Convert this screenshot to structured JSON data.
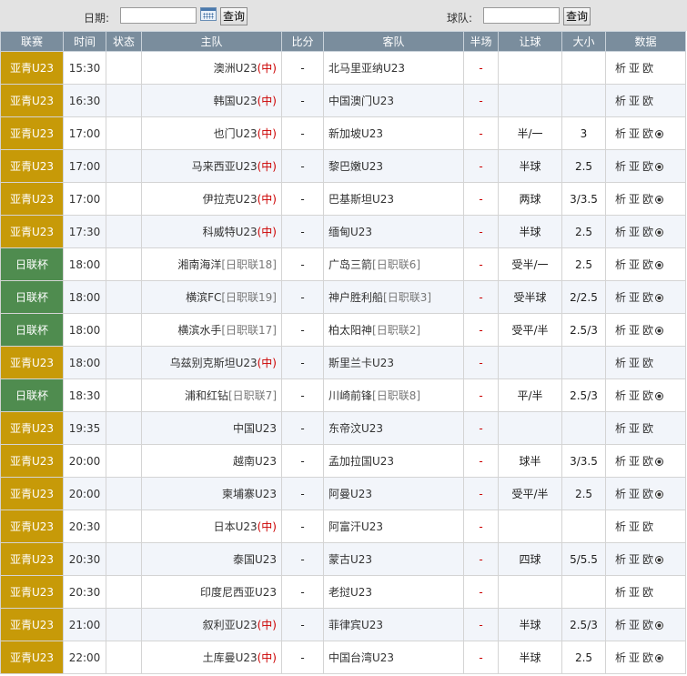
{
  "filter": {
    "date_label": "日期:",
    "date_value": "",
    "query_label": "查询",
    "team_label": "球队:",
    "team_value": ""
  },
  "columns": [
    "联赛",
    "时间",
    "状态",
    "主队",
    "比分",
    "客队",
    "半场",
    "让球",
    "大小",
    "数据"
  ],
  "data_links": [
    "析",
    "亚",
    "欧"
  ],
  "colors": {
    "yq": "#c79a08",
    "jl": "#4f8c4f",
    "header": "#7a8d9d",
    "neutral": "#cc0000"
  },
  "rows": [
    {
      "league": "亚青U23",
      "cls": "yq",
      "time": "15:30",
      "home": "澳洲U23",
      "home_tag": "(中)",
      "home_rank": "",
      "score": "-",
      "away": "北马里亚纳U23",
      "away_rank": "",
      "half": "-",
      "handicap": "",
      "ou": "",
      "ball": false
    },
    {
      "league": "亚青U23",
      "cls": "yq",
      "time": "16:30",
      "home": "韩国U23",
      "home_tag": "(中)",
      "home_rank": "",
      "score": "-",
      "away": "中国澳门U23",
      "away_rank": "",
      "half": "-",
      "handicap": "",
      "ou": "",
      "ball": false
    },
    {
      "league": "亚青U23",
      "cls": "yq",
      "time": "17:00",
      "home": "也门U23",
      "home_tag": "(中)",
      "home_rank": "",
      "score": "-",
      "away": "新加坡U23",
      "away_rank": "",
      "half": "-",
      "handicap": "半/一",
      "ou": "3",
      "ball": true
    },
    {
      "league": "亚青U23",
      "cls": "yq",
      "time": "17:00",
      "home": "马来西亚U23",
      "home_tag": "(中)",
      "home_rank": "",
      "score": "-",
      "away": "黎巴嫩U23",
      "away_rank": "",
      "half": "-",
      "handicap": "半球",
      "ou": "2.5",
      "ball": true
    },
    {
      "league": "亚青U23",
      "cls": "yq",
      "time": "17:00",
      "home": "伊拉克U23",
      "home_tag": "(中)",
      "home_rank": "",
      "score": "-",
      "away": "巴基斯坦U23",
      "away_rank": "",
      "half": "-",
      "handicap": "两球",
      "ou": "3/3.5",
      "ball": true
    },
    {
      "league": "亚青U23",
      "cls": "yq",
      "time": "17:30",
      "home": "科威特U23",
      "home_tag": "(中)",
      "home_rank": "",
      "score": "-",
      "away": "缅甸U23",
      "away_rank": "",
      "half": "-",
      "handicap": "半球",
      "ou": "2.5",
      "ball": true
    },
    {
      "league": "日联杯",
      "cls": "jl",
      "time": "18:00",
      "home": "湘南海洋",
      "home_tag": "",
      "home_rank": "[日职联18]",
      "score": "-",
      "away": "广岛三箭",
      "away_rank": "[日职联6]",
      "half": "-",
      "handicap": "受半/一",
      "ou": "2.5",
      "ball": true
    },
    {
      "league": "日联杯",
      "cls": "jl",
      "time": "18:00",
      "home": "横滨FC",
      "home_tag": "",
      "home_rank": "[日职联19]",
      "score": "-",
      "away": "神户胜利船",
      "away_rank": "[日职联3]",
      "half": "-",
      "handicap": "受半球",
      "ou": "2/2.5",
      "ball": true
    },
    {
      "league": "日联杯",
      "cls": "jl",
      "time": "18:00",
      "home": "横滨水手",
      "home_tag": "",
      "home_rank": "[日职联17]",
      "score": "-",
      "away": "柏太阳神",
      "away_rank": "[日职联2]",
      "half": "-",
      "handicap": "受平/半",
      "ou": "2.5/3",
      "ball": true
    },
    {
      "league": "亚青U23",
      "cls": "yq",
      "time": "18:00",
      "home": "乌兹别克斯坦U23",
      "home_tag": "(中)",
      "home_rank": "",
      "score": "-",
      "away": "斯里兰卡U23",
      "away_rank": "",
      "half": "-",
      "handicap": "",
      "ou": "",
      "ball": false
    },
    {
      "league": "日联杯",
      "cls": "jl",
      "time": "18:30",
      "home": "浦和红钻",
      "home_tag": "",
      "home_rank": "[日职联7]",
      "score": "-",
      "away": "川崎前锋",
      "away_rank": "[日职联8]",
      "half": "-",
      "handicap": "平/半",
      "ou": "2.5/3",
      "ball": true
    },
    {
      "league": "亚青U23",
      "cls": "yq",
      "time": "19:35",
      "home": "中国U23",
      "home_tag": "",
      "home_rank": "",
      "score": "-",
      "away": "东帝汶U23",
      "away_rank": "",
      "half": "-",
      "handicap": "",
      "ou": "",
      "ball": false
    },
    {
      "league": "亚青U23",
      "cls": "yq",
      "time": "20:00",
      "home": "越南U23",
      "home_tag": "",
      "home_rank": "",
      "score": "-",
      "away": "孟加拉国U23",
      "away_rank": "",
      "half": "-",
      "handicap": "球半",
      "ou": "3/3.5",
      "ball": true
    },
    {
      "league": "亚青U23",
      "cls": "yq",
      "time": "20:00",
      "home": "柬埔寨U23",
      "home_tag": "",
      "home_rank": "",
      "score": "-",
      "away": "阿曼U23",
      "away_rank": "",
      "half": "-",
      "handicap": "受平/半",
      "ou": "2.5",
      "ball": true
    },
    {
      "league": "亚青U23",
      "cls": "yq",
      "time": "20:30",
      "home": "日本U23",
      "home_tag": "(中)",
      "home_rank": "",
      "score": "-",
      "away": "阿富汗U23",
      "away_rank": "",
      "half": "-",
      "handicap": "",
      "ou": "",
      "ball": false
    },
    {
      "league": "亚青U23",
      "cls": "yq",
      "time": "20:30",
      "home": "泰国U23",
      "home_tag": "",
      "home_rank": "",
      "score": "-",
      "away": "蒙古U23",
      "away_rank": "",
      "half": "-",
      "handicap": "四球",
      "ou": "5/5.5",
      "ball": true
    },
    {
      "league": "亚青U23",
      "cls": "yq",
      "time": "20:30",
      "home": "印度尼西亚U23",
      "home_tag": "",
      "home_rank": "",
      "score": "-",
      "away": "老挝U23",
      "away_rank": "",
      "half": "-",
      "handicap": "",
      "ou": "",
      "ball": false
    },
    {
      "league": "亚青U23",
      "cls": "yq",
      "time": "21:00",
      "home": "叙利亚U23",
      "home_tag": "(中)",
      "home_rank": "",
      "score": "-",
      "away": "菲律宾U23",
      "away_rank": "",
      "half": "-",
      "handicap": "半球",
      "ou": "2.5/3",
      "ball": true
    },
    {
      "league": "亚青U23",
      "cls": "yq",
      "time": "22:00",
      "home": "土库曼U23",
      "home_tag": "(中)",
      "home_rank": "",
      "score": "-",
      "away": "中国台湾U23",
      "away_rank": "",
      "half": "-",
      "handicap": "半球",
      "ou": "2.5",
      "ball": true
    }
  ]
}
